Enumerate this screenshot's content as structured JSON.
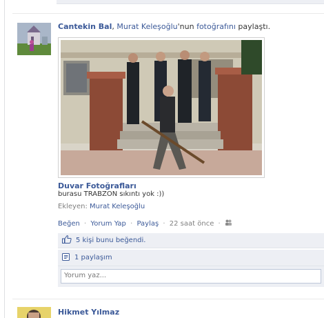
{
  "story": {
    "actor_name": "Cantekin Bal",
    "separator": ", ",
    "owner_name": "Murat Keleşoğlu",
    "owner_suffix": "'nun ",
    "object_link": "fotoğrafını",
    "verb": " paylaştı.",
    "album_title": "Duvar Fotoğrafları",
    "caption": "burasu TRABZON sıkıntı yok :))",
    "added_by_label": "Ekleyen: ",
    "added_by_name": "Murat Keleşoğlu",
    "actions": {
      "like": "Beğen",
      "comment": "Yorum Yap",
      "share": "Paylaş",
      "timestamp": "22 saat önce",
      "dot": "·"
    },
    "likes_text": "5 kişi bunu beğendi.",
    "shares_text": "1 paylaşım",
    "comment_placeholder": "Yorum yaz..."
  },
  "next_story": {
    "actor_name": "Hikmet Yılmaz"
  },
  "colors": {
    "link": "#3b5998",
    "ufi_background": "#edeff4",
    "meta_text": "#808080"
  },
  "icons": {
    "privacy": "friends-icon",
    "like": "thumbs-up-icon",
    "share": "share-icon"
  }
}
